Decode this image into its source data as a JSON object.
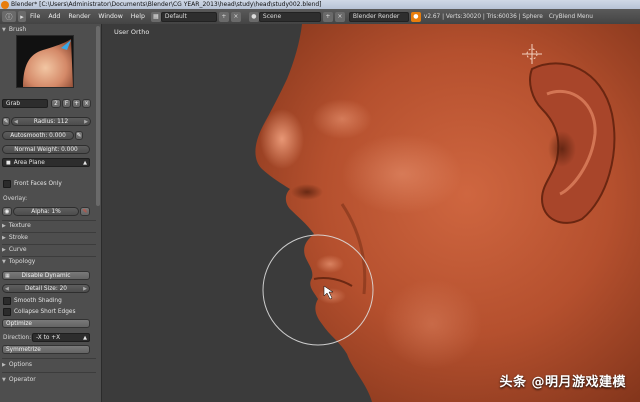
{
  "window": {
    "title": "Blender* [C:\\Users\\Administrator\\Documents\\Blender\\CG YEAR_2013\\head\\study\\head\\study002.blend]"
  },
  "menu": [
    "File",
    "Add",
    "Render",
    "Window",
    "Help"
  ],
  "header": {
    "screen_layout": "Default",
    "scene": "Scene",
    "render_engine": "Blender Render",
    "stats": "v2.67 | Verts:30020 | Tris:60036 | Sphere",
    "addon_menu": "CryBlend Menu"
  },
  "brush": {
    "section": "Brush",
    "name": "Grab",
    "users": "2",
    "f_label": "F",
    "radius": "Radius: 112",
    "autosmooth": "Autosmooth: 0.000",
    "normal_weight": "Normal Weight: 0.000",
    "plane": "Area Plane",
    "front_faces_only": "Front Faces Only",
    "overlay_label": "Overlay:",
    "alpha": "Alpha: 1%"
  },
  "sections": {
    "texture": "Texture",
    "stroke": "Stroke",
    "curve": "Curve"
  },
  "topology": {
    "section": "Topology",
    "disable_dynamic": "Disable Dynamic",
    "detail_size": "Detail Size: 20",
    "smooth_shading": "Smooth Shading",
    "collapse_short_edges": "Collapse Short Edges",
    "optimize": "Optimize",
    "direction_label": "Direction:",
    "direction_value": "-X to +X",
    "symmetrize": "Symmetrize"
  },
  "options": "Options",
  "operator": "Operator",
  "viewport": {
    "label": "User Ortho"
  },
  "watermark": "头条 @明月游戏建模",
  "colors": {
    "clay": "#b8502e",
    "clay_highlight": "#e58a66",
    "viewport_bg": "#3b3b3b",
    "panel_bg": "#4e4e4e"
  }
}
